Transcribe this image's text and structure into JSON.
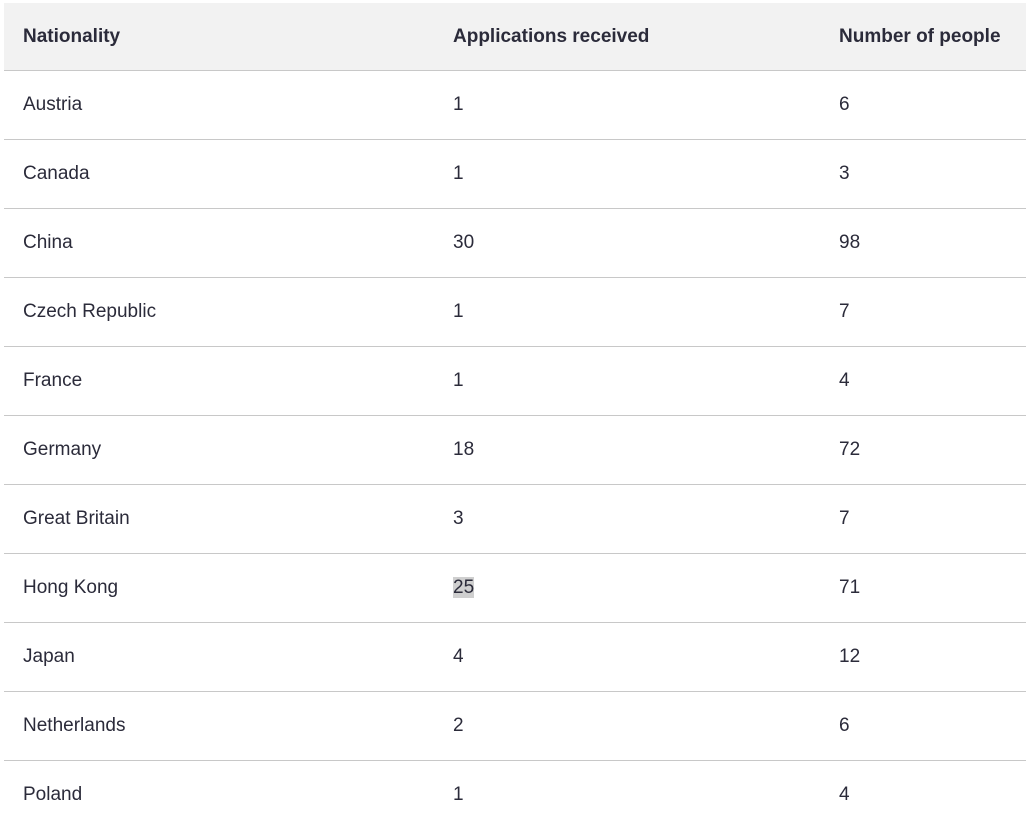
{
  "table": {
    "headers": [
      "Nationality",
      "Applications received",
      "Number of people"
    ],
    "rows": [
      {
        "nationality": "Austria",
        "applications": "1",
        "people": "6"
      },
      {
        "nationality": "Canada",
        "applications": "1",
        "people": "3"
      },
      {
        "nationality": "China",
        "applications": "30",
        "people": "98"
      },
      {
        "nationality": "Czech Republic",
        "applications": "1",
        "people": "7"
      },
      {
        "nationality": "France",
        "applications": "1",
        "people": "4"
      },
      {
        "nationality": "Germany",
        "applications": "18",
        "people": "72"
      },
      {
        "nationality": "Great Britain",
        "applications": "3",
        "people": "7"
      },
      {
        "nationality": "Hong Kong",
        "applications": "25",
        "people": "71"
      },
      {
        "nationality": "Japan",
        "applications": "4",
        "people": "12"
      },
      {
        "nationality": "Netherlands",
        "applications": "2",
        "people": "6"
      },
      {
        "nationality": "Poland",
        "applications": "1",
        "people": "4"
      }
    ],
    "highlighted_cell": {
      "row": 7,
      "column": "applications"
    }
  },
  "colors": {
    "header_background": "#f2f2f2",
    "text": "#2b2b3a",
    "row_border": "#c8c8c8",
    "selection_highlight": "#cfcfcf"
  }
}
